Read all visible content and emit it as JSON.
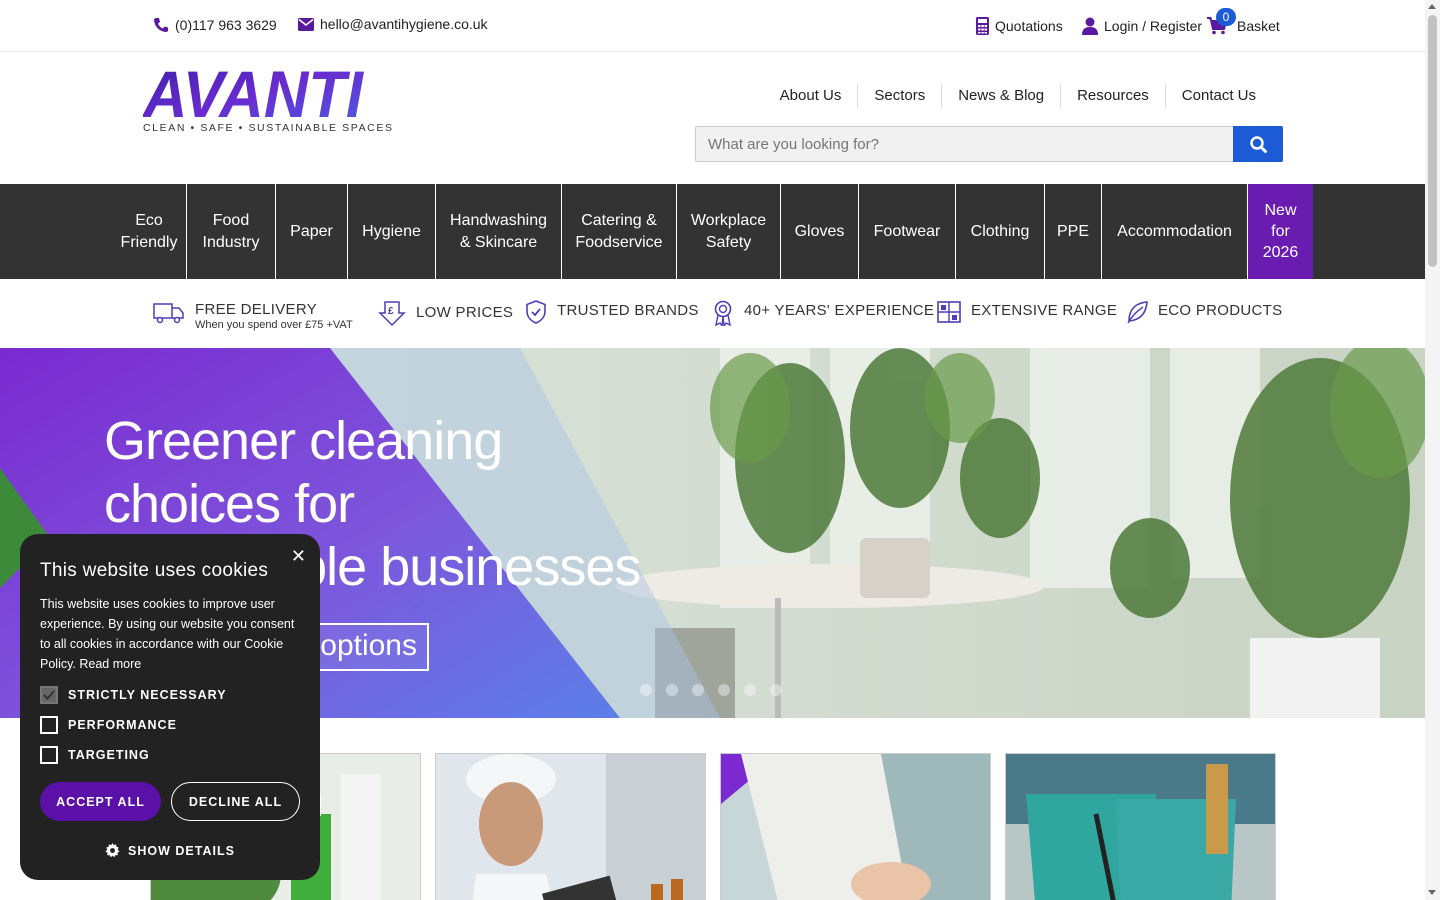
{
  "topbar": {
    "phone": "(0)117 963 3629",
    "email": "hello@avantihygiene.co.uk",
    "quotations": "Quotations",
    "login": "Login / Register",
    "basket_count": "0",
    "basket": "Basket"
  },
  "logo": {
    "wordmark": "AVANTI",
    "tagline": "CLEAN • SAFE • SUSTAINABLE SPACES"
  },
  "topnav": [
    "About Us",
    "Sectors",
    "News & Blog",
    "Resources",
    "Contact Us"
  ],
  "search": {
    "placeholder": "What are you looking for?"
  },
  "categories": [
    {
      "l1": "Eco",
      "l2": "Friendly"
    },
    {
      "l1": "Food",
      "l2": "Industry"
    },
    {
      "l1": "Paper",
      "l2": ""
    },
    {
      "l1": "Hygiene",
      "l2": ""
    },
    {
      "l1": "Handwashing",
      "l2": "& Skincare"
    },
    {
      "l1": "Catering &",
      "l2": "Foodservice"
    },
    {
      "l1": "Workplace",
      "l2": "Safety"
    },
    {
      "l1": "Gloves",
      "l2": ""
    },
    {
      "l1": "Footwear",
      "l2": ""
    },
    {
      "l1": "Clothing",
      "l2": ""
    },
    {
      "l1": "PPE",
      "l2": ""
    },
    {
      "l1": "Accommodation",
      "l2": ""
    }
  ],
  "category_new": {
    "l1": "New",
    "l2": "for",
    "l3": "2026"
  },
  "usp": {
    "delivery": "FREE DELIVERY",
    "delivery_sub": "When you spend over £75 +VAT",
    "prices": "LOW PRICES",
    "brands": "TRUSTED BRANDS",
    "experience": "40+ YEARS' EXPERIENCE",
    "range": "EXTENSIVE RANGE",
    "eco": "ECO PRODUCTS"
  },
  "hero": {
    "line1": "Greener cleaning",
    "line2": "choices for",
    "line3": "sustainable businesses",
    "button": "Explore options"
  },
  "cookie": {
    "title": "This website uses cookies",
    "body": "This website uses cookies to improve user experience. By using our website you consent to all cookies in accordance with our Cookie Policy.",
    "read_more": "Read more",
    "strictly": "STRICTLY NECESSARY",
    "performance": "PERFORMANCE",
    "targeting": "TARGETING",
    "accept": "ACCEPT ALL",
    "decline": "DECLINE ALL",
    "details": "SHOW DETAILS"
  },
  "colors": {
    "brand_purple": "#5a1aa0",
    "nav_dark": "#333333",
    "search_blue": "#1d5bd6",
    "new_purple": "#6a1bb0"
  }
}
